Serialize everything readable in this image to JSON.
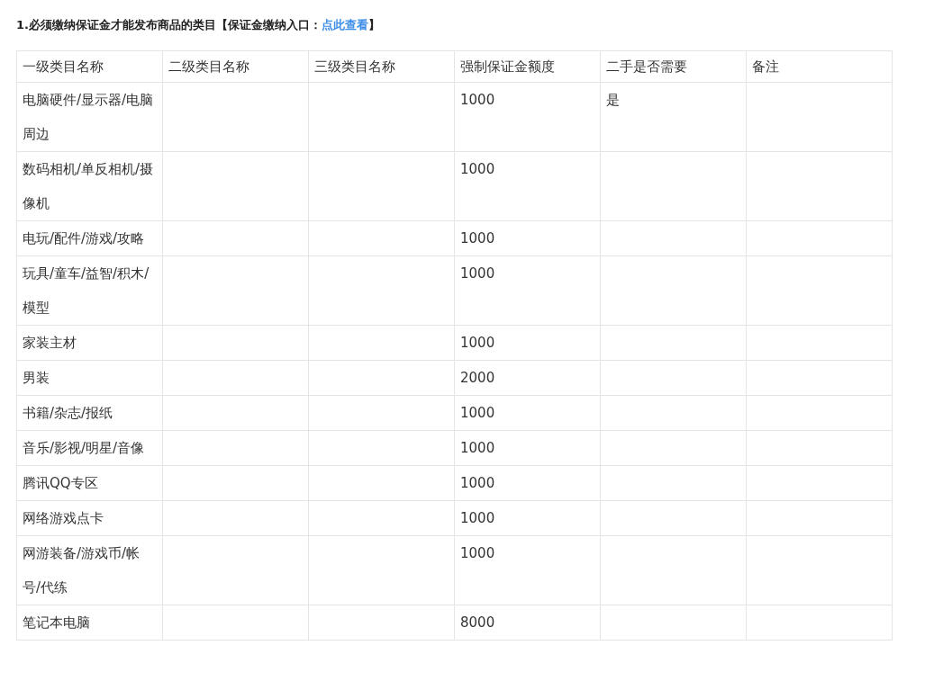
{
  "heading": {
    "text": "1.必须缴纳保证金才能发布商品的类目【保证金缴纳入口：",
    "link": "点此查看",
    "suffix": "】"
  },
  "table": {
    "columns": [
      "一级类目名称",
      "二级类目名称",
      "三级类目名称",
      "强制保证金额度",
      "二手是否需要",
      "备注"
    ],
    "rows": [
      {
        "level_1": "电脑硬件/显示器/电脑周边",
        "amount": "1000",
        "second_hand": "是"
      },
      {
        "level_1": "数码相机/单反相机/摄像机",
        "amount": "1000"
      },
      {
        "level_1": "电玩/配件/游戏/攻略",
        "amount": "1000"
      },
      {
        "level_1": "玩具/童车/益智/积木/模型",
        "amount": "1000"
      },
      {
        "level_1": "家装主材",
        "amount": "1000"
      },
      {
        "level_1": "男装",
        "amount": "2000"
      },
      {
        "level_1": "书籍/杂志/报纸",
        "amount": "1000"
      },
      {
        "level_1": "音乐/影视/明星/音像",
        "amount": "1000"
      },
      {
        "level_1": "腾讯QQ专区",
        "amount": "1000"
      },
      {
        "level_1": "网络游戏点卡",
        "amount": "1000"
      },
      {
        "level_1": "网游装备/游戏币/帐号/代练",
        "amount": "1000"
      },
      {
        "level_1": "笔记本电脑",
        "amount": "8000"
      }
    ]
  }
}
